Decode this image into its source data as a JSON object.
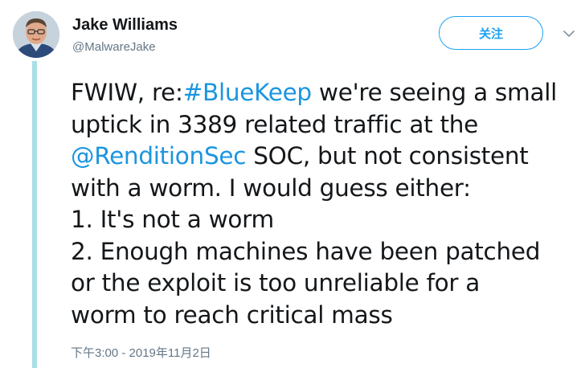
{
  "author": {
    "name": "Jake Williams",
    "handle": "@MalwareJake"
  },
  "follow_button": {
    "label": "关注"
  },
  "tweet": {
    "lines": [
      {
        "pre": "FWIW, re:",
        "link": "#BlueKeep",
        "post": " we're seeing a small"
      },
      {
        "text": "uptick in 3389 related traffic at the"
      },
      {
        "link": "@RenditionSec",
        "post": " SOC, but not consistent"
      },
      {
        "text": "with a worm. I would guess either:"
      },
      {
        "text": "1. It's not a worm"
      },
      {
        "text": "2. Enough machines have been patched"
      },
      {
        "text": "or the exploit is too unreliable for a"
      },
      {
        "text": "worm to reach critical mass"
      }
    ],
    "timestamp": "下午3:00 - 2019年11月2日"
  },
  "colors": {
    "link": "#1b95e0",
    "follow": "#1da1f2",
    "thread_line": "#a8dfe6"
  }
}
